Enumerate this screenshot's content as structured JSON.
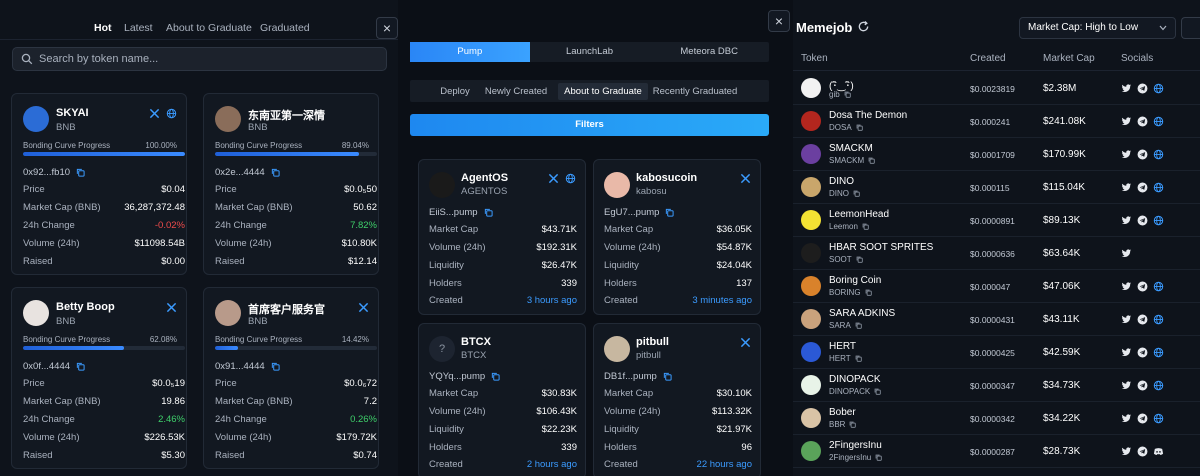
{
  "left": {
    "tabs": [
      "Hot",
      "Latest",
      "About to Graduate",
      "Graduated"
    ],
    "active_tab": "Hot",
    "search_placeholder": "Search by token name...",
    "close_label": "×",
    "row_labels": {
      "bonding": "Bonding Curve Progress",
      "price": "Price",
      "mcap": "Market Cap (BNB)",
      "change": "24h Change",
      "volume": "Volume (24h)",
      "raised": "Raised"
    },
    "cards": [
      {
        "name": "SKYAI",
        "symbol": "BNB",
        "progress": "100.00%",
        "progress_value": 1.0,
        "address": "0x92...fb10",
        "price": "$0.04",
        "mcap": "36,287,372.48",
        "change": "-0.02%",
        "change_dir": "down",
        "volume": "$11098.54B",
        "raised": "$0.00",
        "avatar_color": "#2b6cd6",
        "socials": [
          "x-icon",
          "globe-icon"
        ]
      },
      {
        "name": "东南亚第一深情",
        "symbol": "BNB",
        "progress": "89.04%",
        "progress_value": 0.8904,
        "address": "0x2e...4444",
        "price": "$0.0₅50",
        "mcap": "50.62",
        "change": "7.82%",
        "change_dir": "up",
        "volume": "$10.80K",
        "raised": "$12.14",
        "avatar_color": "#8a6d5a",
        "socials": []
      },
      {
        "name": "Betty Boop",
        "symbol": "BNB",
        "progress": "62.08%",
        "progress_value": 0.6208,
        "address": "0x0f...4444",
        "price": "$0.0₅19",
        "mcap": "19.86",
        "change": "2.46%",
        "change_dir": "up",
        "volume": "$226.53K",
        "raised": "$5.30",
        "avatar_color": "#e8e3e0",
        "socials": [
          "x-icon"
        ]
      },
      {
        "name": "首席客户服务官",
        "symbol": "BNB",
        "progress": "14.42%",
        "progress_value": 0.1442,
        "address": "0x91...4444",
        "price": "$0.0₆72",
        "mcap": "7.2",
        "change": "0.26%",
        "change_dir": "up",
        "volume": "$179.72K",
        "raised": "$0.74",
        "avatar_color": "#b89a8a",
        "socials": [
          "x-icon"
        ]
      }
    ]
  },
  "middle": {
    "close_label": "×",
    "seg1": [
      "Pump",
      "LaunchLab",
      "Meteora DBC"
    ],
    "seg1_active": "Pump",
    "seg2": [
      "Deploy",
      "Newly Created",
      "About to Graduate",
      "Recently Graduated"
    ],
    "seg2_active": "About to Graduate",
    "filters_label": "Filters",
    "row_labels": {
      "mcap": "Market Cap",
      "volume": "Volume (24h)",
      "liquidity": "Liquidity",
      "holders": "Holders",
      "created": "Created"
    },
    "cards": [
      {
        "name": "AgentOS",
        "symbol": "AGENTOS",
        "address": "EiiS...pump",
        "mcap": "$43.71K",
        "volume": "$192.31K",
        "liquidity": "$26.47K",
        "holders": "339",
        "created": "3 hours ago",
        "avatar_color": "#1a1a1a",
        "socials": [
          "x-icon",
          "globe-icon"
        ]
      },
      {
        "name": "kabosucoin",
        "symbol": "kabosu",
        "address": "EgU7...pump",
        "mcap": "$36.05K",
        "volume": "$54.87K",
        "liquidity": "$24.04K",
        "holders": "137",
        "created": "3 minutes ago",
        "avatar_color": "#e9b9a8",
        "socials": [
          "x-icon"
        ]
      },
      {
        "name": "BTCX",
        "symbol": "BTCX",
        "address": "YQYq...pump",
        "mcap": "$30.83K",
        "volume": "$106.43K",
        "liquidity": "$22.23K",
        "holders": "339",
        "created": "2 hours ago",
        "avatar_color": "#1d2430",
        "avatar_glyph": "?",
        "socials": []
      },
      {
        "name": "pitbull",
        "symbol": "pitbull",
        "address": "DB1f...pump",
        "mcap": "$30.10K",
        "volume": "$113.32K",
        "liquidity": "$21.97K",
        "holders": "96",
        "created": "22 hours ago",
        "avatar_color": "#c7b7a0",
        "socials": [
          "x-icon"
        ]
      }
    ]
  },
  "right": {
    "title": "Memejob",
    "sort_label": "Market Cap: High to Low",
    "headers": {
      "token": "Token",
      "created": "Created",
      "mcap": "Market Cap",
      "socials": "Socials"
    },
    "rows": [
      {
        "name": "(･ิ‿･ิ)",
        "symbol": "gib",
        "created": "$0.0023819",
        "mcap": "$2.38M",
        "avatar_color": "#f2f2f2",
        "socials": [
          "twitter-icon",
          "telegram-icon",
          "globe-icon"
        ]
      },
      {
        "name": "Dosa The Demon",
        "symbol": "DOSA",
        "created": "$0.000241",
        "mcap": "$241.08K",
        "avatar_color": "#b3261e",
        "socials": [
          "twitter-icon",
          "telegram-icon",
          "globe-icon"
        ]
      },
      {
        "name": "SMACKM",
        "symbol": "SMACKM",
        "created": "$0.0001709",
        "mcap": "$170.99K",
        "avatar_color": "#6b3fa0",
        "socials": [
          "twitter-icon",
          "telegram-icon",
          "globe-icon"
        ]
      },
      {
        "name": "DINO",
        "symbol": "DINO",
        "created": "$0.000115",
        "mcap": "$115.04K",
        "avatar_color": "#c9a66b",
        "socials": [
          "twitter-icon",
          "telegram-icon",
          "globe-icon"
        ]
      },
      {
        "name": "LeemonHead",
        "symbol": "Leemon",
        "created": "$0.0000891",
        "mcap": "$89.13K",
        "avatar_color": "#f3e233",
        "socials": [
          "twitter-icon",
          "telegram-icon",
          "globe-icon"
        ]
      },
      {
        "name": "HBAR SOOT SPRITES",
        "symbol": "SOOT",
        "created": "$0.0000636",
        "mcap": "$63.64K",
        "avatar_color": "#1d1d1d",
        "socials": [
          "twitter-icon"
        ]
      },
      {
        "name": "Boring Coin",
        "symbol": "BORING",
        "created": "$0.000047",
        "mcap": "$47.06K",
        "avatar_color": "#d9822b",
        "socials": [
          "twitter-icon",
          "telegram-icon",
          "globe-icon"
        ]
      },
      {
        "name": "SARA ADKINS",
        "symbol": "SARA",
        "created": "$0.0000431",
        "mcap": "$43.11K",
        "avatar_color": "#caa27c",
        "socials": [
          "twitter-icon",
          "telegram-icon",
          "globe-icon"
        ]
      },
      {
        "name": "HERT",
        "symbol": "HERT",
        "created": "$0.0000425",
        "mcap": "$42.59K",
        "avatar_color": "#2b59d6",
        "socials": [
          "twitter-icon",
          "telegram-icon",
          "globe-icon"
        ]
      },
      {
        "name": "DINOPACK",
        "symbol": "DINOPACK",
        "created": "$0.0000347",
        "mcap": "$34.73K",
        "avatar_color": "#e8f3e8",
        "socials": [
          "twitter-icon",
          "telegram-icon",
          "globe-icon"
        ]
      },
      {
        "name": "Bober",
        "symbol": "BBR",
        "created": "$0.0000342",
        "mcap": "$34.22K",
        "avatar_color": "#d9c3a6",
        "socials": [
          "twitter-icon",
          "telegram-icon",
          "globe-icon"
        ]
      },
      {
        "name": "2FingersInu",
        "symbol": "2FingersInu",
        "created": "$0.0000287",
        "mcap": "$28.73K",
        "avatar_color": "#5aa35a",
        "socials": [
          "twitter-icon",
          "telegram-icon",
          "discord-icon"
        ]
      }
    ]
  },
  "colors": {
    "accent": "#2d8bff",
    "up": "#3ecf6a",
    "down": "#ef4b4b",
    "link": "#3b9bff"
  }
}
